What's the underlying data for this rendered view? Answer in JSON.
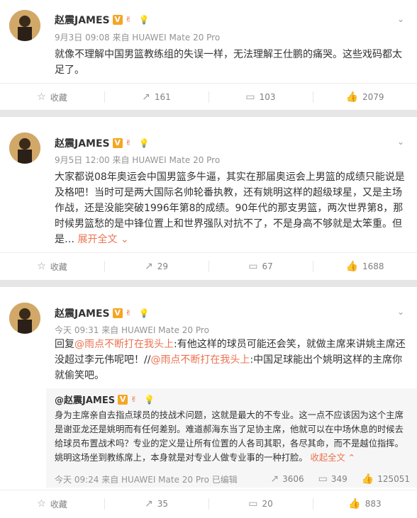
{
  "posts": [
    {
      "author": "赵震JAMES",
      "meta": "9月3日 09:08 来自 HUAWEI Mate 20 Pro",
      "text": "就像不理解中国男篮教练组的失误一样，无法理解王仕鹏的痛哭。这些戏码都太足了。",
      "actions": {
        "favorite": "收藏",
        "repost": "161",
        "comment": "103",
        "like": "2079"
      }
    },
    {
      "author": "赵震JAMES",
      "meta": "9月5日 12:00 来自 HUAWEI Mate 20 Pro",
      "text": "大家都说08年奥运会中国男篮多牛逼，其实在那届奥运会上男篮的成绩只能说是及格吧！当时可是两大国际名帅轮番执教，还有姚明这样的超级球星，又是主场作战，还是没能突破1996年第8的成绩。90年代的那支男篮，两次世界第8，那时候男篮愁的是中锋位置上和世界强队对抗不了，不是身高不够就是太笨重。但是…",
      "expand": "展开全文",
      "actions": {
        "favorite": "收藏",
        "repost": "29",
        "comment": "67",
        "like": "1688"
      }
    },
    {
      "author": "赵震JAMES",
      "meta": "今天 09:31 来自 HUAWEI Mate 20 Pro",
      "text_prefix": "回复",
      "mention1": "@雨点不断打在我头上",
      "text_mid": ":有他这样的球员可能还会笑，就做主席来讲姚主席还没超过李元伟呢吧！//",
      "mention2": "@雨点不断打在我头上",
      "text_end": ":中国足球能出个姚明这样的主席你就偷笑吧。",
      "repost": {
        "author": "@赵震JAMES",
        "text": "身为主席亲自去指点球员的技战术问题，这就是最大的不专业。这一点不应该因为这个主席是谢亚龙还是姚明而有任何差别。难道郝海东当了足协主席，他就可以在中场休息的时候去给球员布置战术吗？专业的定义是让所有位置的人各司其职，各尽其命，而不是越位指挥。姚明这场坐到教练席上，本身就是对专业人做专业事的一种打脸。",
        "collapse": "收起全文",
        "meta": "今天 09:24 来自 HUAWEI Mate 20 Pro 已编辑",
        "reposts": "3606",
        "comments": "349",
        "likes": "125051"
      },
      "actions": {
        "favorite": "收藏",
        "repost": "35",
        "comment": "20",
        "like": "883"
      }
    }
  ],
  "icons": {
    "favorite": "star-icon",
    "repost": "share-icon",
    "comment": "comment-icon",
    "like": "thumb-up-icon",
    "menu": "chevron-down-icon"
  },
  "colors": {
    "link": "#eb7350",
    "badge": "#f5a623",
    "meta": "#939393",
    "separator": "#e6e6e6"
  }
}
